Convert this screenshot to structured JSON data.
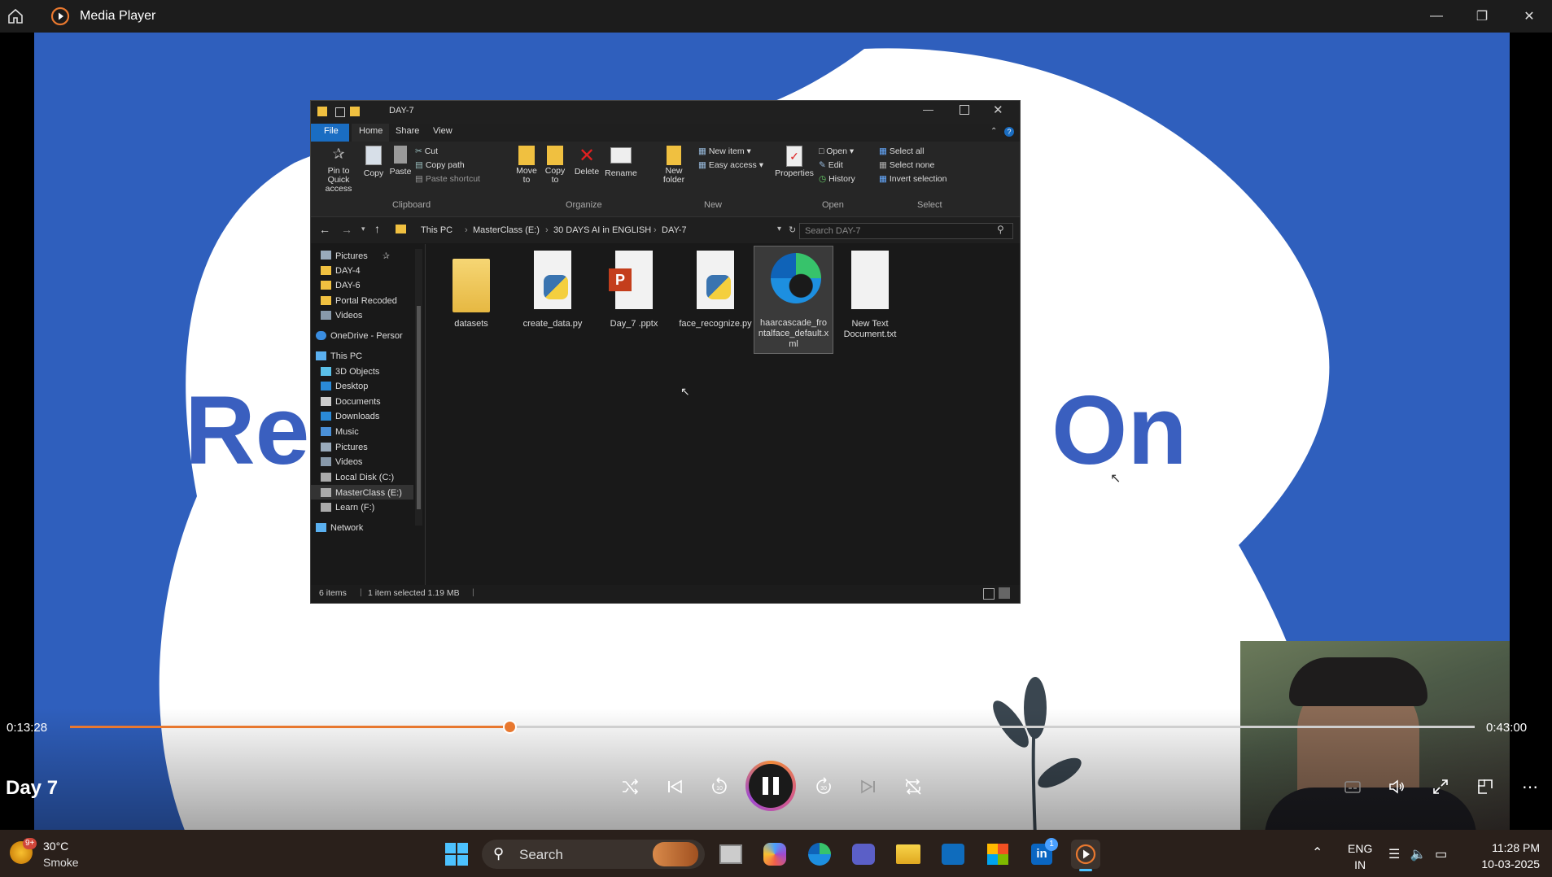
{
  "window": {
    "title": "Media Player"
  },
  "explorer": {
    "title": "DAY-7",
    "tabs": [
      "File",
      "Home",
      "Share",
      "View"
    ],
    "ribbon": {
      "clipboard": {
        "label": "Clipboard",
        "pin": "Pin to Quick access",
        "copy": "Copy",
        "paste": "Paste",
        "cut": "Cut",
        "copy_path": "Copy path",
        "paste_shortcut": "Paste shortcut"
      },
      "organize": {
        "label": "Organize",
        "move_to": "Move to",
        "copy_to": "Copy to",
        "delete": "Delete",
        "rename": "Rename"
      },
      "new": {
        "label": "New",
        "new_folder": "New folder",
        "new_item": "New item",
        "easy_access": "Easy access"
      },
      "open": {
        "label": "Open",
        "properties": "Properties",
        "open": "Open",
        "edit": "Edit",
        "history": "History"
      },
      "select": {
        "label": "Select",
        "select_all": "Select all",
        "select_none": "Select none",
        "invert": "Invert selection"
      }
    },
    "breadcrumb": [
      "This PC",
      "MasterClass (E:)",
      "30 DAYS AI in ENGLISH",
      "DAY-7"
    ],
    "search_placeholder": "Search DAY-7",
    "nav": [
      "Pictures",
      "DAY-4",
      "DAY-6",
      "Portal Recoded",
      "Videos",
      "OneDrive - Persor",
      "This PC",
      "3D Objects",
      "Desktop",
      "Documents",
      "Downloads",
      "Music",
      "Pictures",
      "Videos",
      "Local Disk (C:)",
      "MasterClass (E:)",
      "Learn (F:)",
      "Network"
    ],
    "files": [
      {
        "name": "datasets",
        "icon": "folder-icon"
      },
      {
        "name": "create_data.py",
        "icon": "python-file-icon"
      },
      {
        "name": "Day_7 .pptx",
        "icon": "powerpoint-file-icon"
      },
      {
        "name": "face_recognize.py",
        "icon": "python-file-icon"
      },
      {
        "name": "haarcascade_frontalface_default.xml",
        "icon": "edge-file-icon"
      },
      {
        "name": "New Text Document.txt",
        "icon": "text-file-icon"
      }
    ],
    "status": {
      "items": "6 items",
      "selected": "1 item selected  1.19 MB"
    }
  },
  "slide": {
    "text_left": "Re",
    "text_right": "On"
  },
  "player": {
    "current_time": "0:13:28",
    "total_time": "0:43:00",
    "progress": 0.3131,
    "video_title": "Day 7"
  },
  "taskbar": {
    "weather_temp": "30°C",
    "weather_desc": "Smoke",
    "weather_badge": "9+",
    "search_label": "Search",
    "lang_top": "ENG",
    "lang_bottom": "IN",
    "time": "11:28 PM",
    "date": "10-03-2025",
    "linkedin_badge": "1"
  },
  "colors": {
    "accent": "#e8782f",
    "video_bg": "#2f5fbd",
    "taskbar": "#2a201b"
  }
}
